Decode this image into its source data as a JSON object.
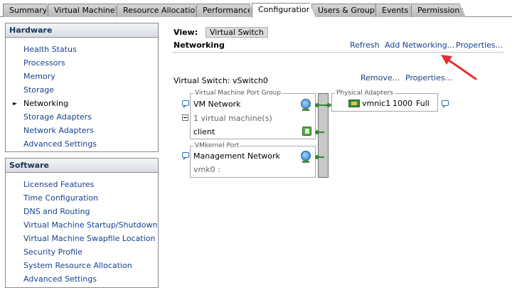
{
  "tabs": [
    {
      "label": "Summary",
      "active": false
    },
    {
      "label": "Virtual Machines",
      "active": false
    },
    {
      "label": "Resource Allocation",
      "active": false
    },
    {
      "label": "Performance",
      "active": false
    },
    {
      "label": "Configuration",
      "active": true
    },
    {
      "label": "Users & Groups",
      "active": false
    },
    {
      "label": "Events",
      "active": false
    },
    {
      "label": "Permissions",
      "active": false
    }
  ],
  "hardware": {
    "title": "Hardware",
    "items": [
      "Health Status",
      "Processors",
      "Memory",
      "Storage",
      "Networking",
      "Storage Adapters",
      "Network Adapters",
      "Advanced Settings"
    ],
    "selected": "Networking"
  },
  "software": {
    "title": "Software",
    "items": [
      "Licensed Features",
      "Time Configuration",
      "DNS and Routing",
      "Virtual Machine Startup/Shutdown",
      "Virtual Machine Swapfile Location",
      "Security Profile",
      "System Resource Allocation",
      "Advanced Settings"
    ]
  },
  "view": {
    "label": "View:",
    "button": "Virtual Switch"
  },
  "networking": {
    "title": "Networking",
    "refresh": "Refresh",
    "add": "Add Networking...",
    "properties": "Properties..."
  },
  "vswitch": {
    "title": "Virtual Switch: vSwitch0",
    "remove": "Remove...",
    "properties": "Properties...",
    "vm_group": {
      "title": "Virtual Machine Port Group",
      "name": "VM Network",
      "count": "1 virtual machine(s)",
      "vm": "client"
    },
    "vmk_group": {
      "title": "VMkernel Port",
      "name": "Management Network",
      "port": "vmk0 :"
    },
    "adapters": {
      "title": "Physical Adapters",
      "name": "vmnic1",
      "speed": "1000",
      "duplex": "Full"
    }
  },
  "colors": {
    "link": "#17408f",
    "wire": "#2e8b2e",
    "arrow": "#e53030"
  }
}
